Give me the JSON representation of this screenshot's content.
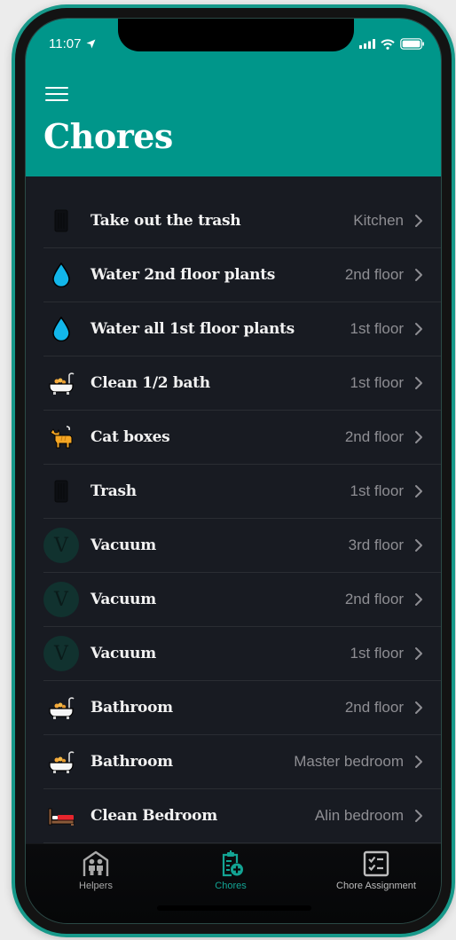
{
  "status_bar": {
    "time": "11:07",
    "location_icon": "location-arrow-icon",
    "signal_icon": "cellular-signal-icon",
    "wifi_icon": "wifi-icon",
    "battery_icon": "battery-icon"
  },
  "header": {
    "menu_icon": "hamburger-menu-icon",
    "title": "Chores",
    "background_color": "#00968a"
  },
  "chores": [
    {
      "title": "Take out the trash",
      "location": "Kitchen",
      "icon": "trash-can-icon"
    },
    {
      "title": "Water 2nd floor plants",
      "location": "2nd floor",
      "icon": "droplet-icon"
    },
    {
      "title": "Water all 1st floor plants",
      "location": "1st floor",
      "icon": "droplet-icon"
    },
    {
      "title": "Clean 1/2 bath",
      "location": "1st floor",
      "icon": "bathtub-icon"
    },
    {
      "title": "Cat boxes",
      "location": "2nd floor",
      "icon": "cat-icon"
    },
    {
      "title": "Trash",
      "location": "1st floor",
      "icon": "trash-can-icon"
    },
    {
      "title": "Vacuum",
      "location": "3rd floor",
      "icon": "letter-avatar",
      "avatar_letter": "V"
    },
    {
      "title": "Vacuum",
      "location": "2nd floor",
      "icon": "letter-avatar",
      "avatar_letter": "V"
    },
    {
      "title": "Vacuum",
      "location": "1st floor",
      "icon": "letter-avatar",
      "avatar_letter": "V"
    },
    {
      "title": "Bathroom",
      "location": "2nd floor",
      "icon": "bathtub-icon"
    },
    {
      "title": "Bathroom",
      "location": "Master bedroom",
      "icon": "bathtub-icon"
    },
    {
      "title": "Clean Bedroom",
      "location": "Alin bedroom",
      "icon": "bed-icon"
    }
  ],
  "tabbar": {
    "tabs": [
      {
        "label": "Helpers",
        "icon": "helpers-house-icon",
        "active": false
      },
      {
        "label": "Chores",
        "icon": "clipboard-add-icon",
        "active": true
      },
      {
        "label": "Chore Assignment",
        "icon": "checklist-icon",
        "active": false
      }
    ],
    "active_color": "#13a494",
    "inactive_color": "#a9a9a9"
  }
}
